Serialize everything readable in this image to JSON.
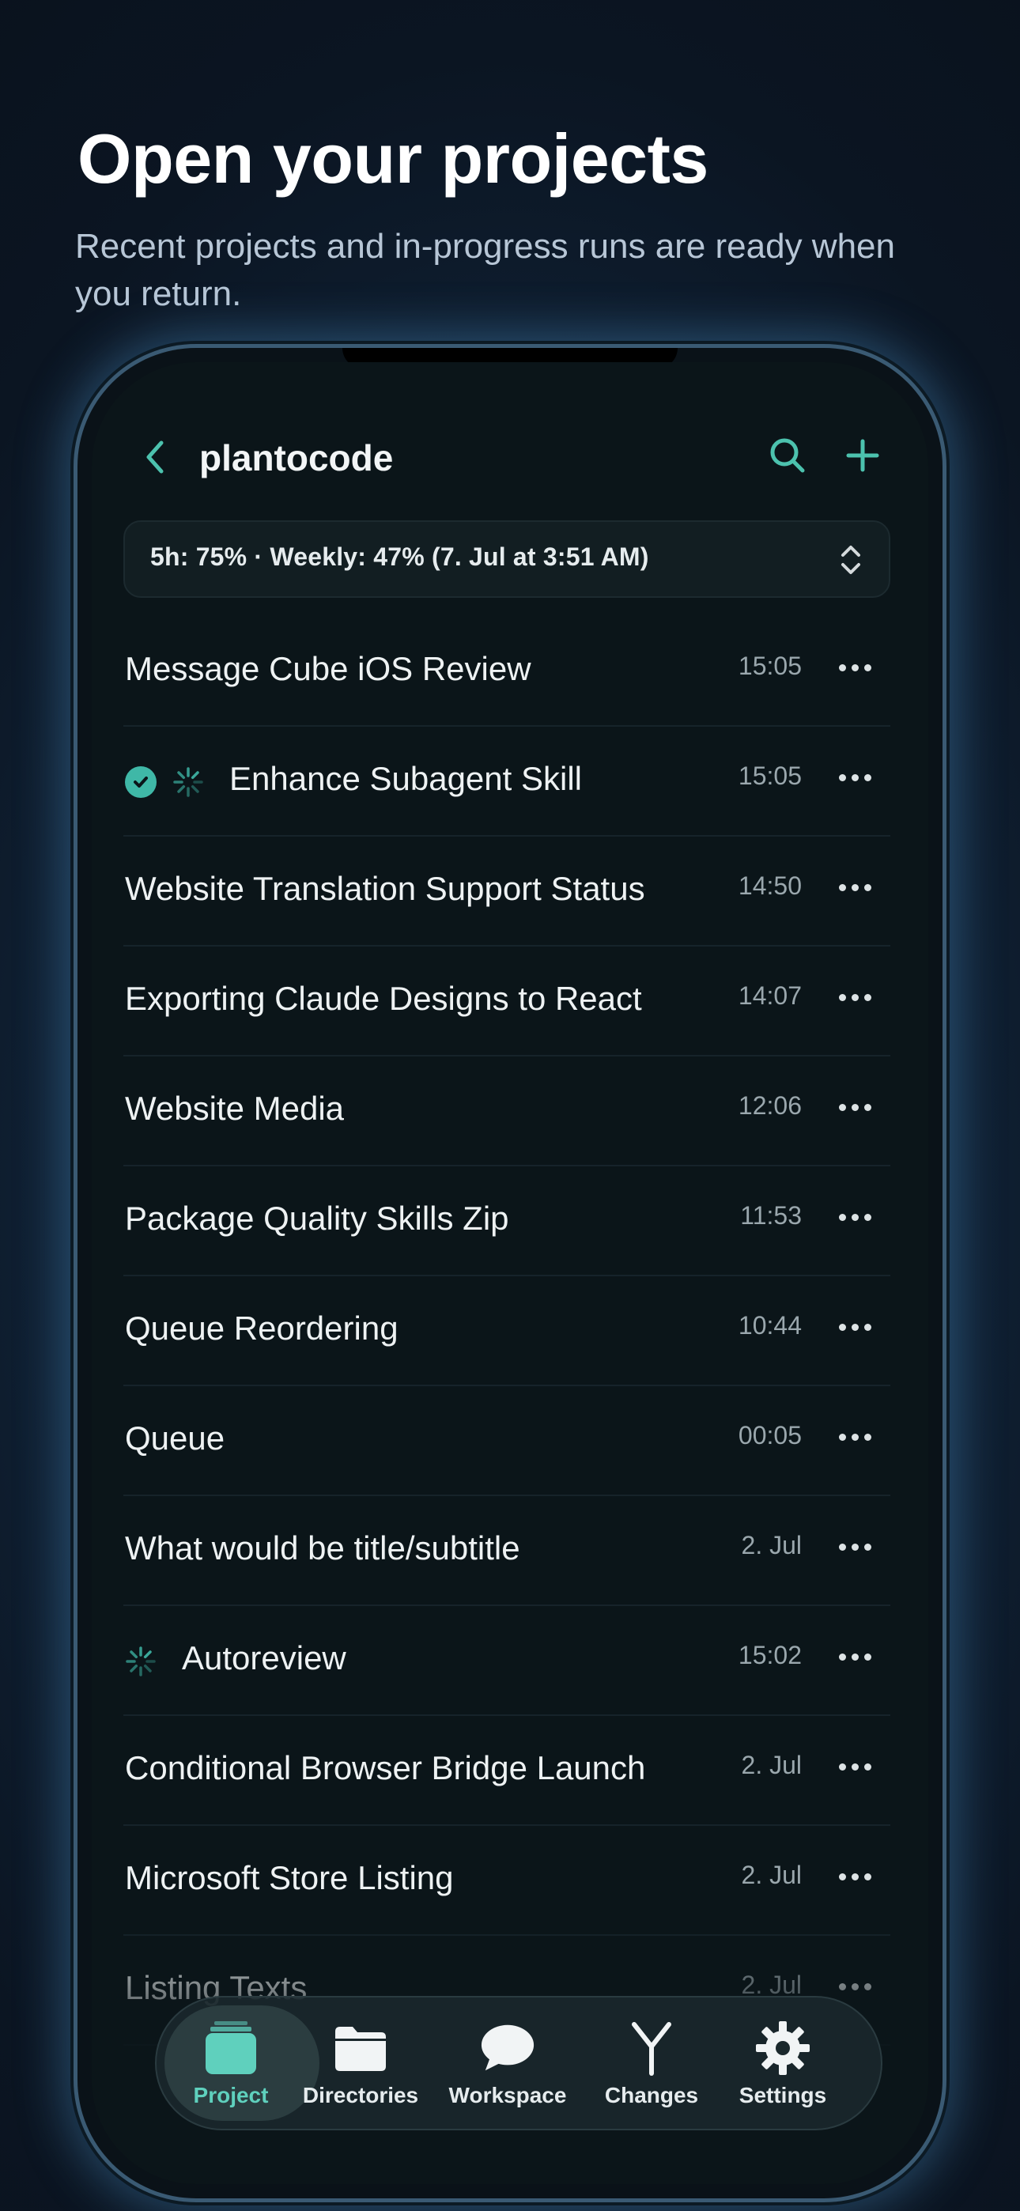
{
  "hero": {
    "title": "Open your projects",
    "subtitle": "Recent projects and in-progress runs are ready when you return."
  },
  "app": {
    "title": "plantocode",
    "back_icon": "chevron-left-icon",
    "search_icon": "search-icon",
    "add_icon": "plus-icon",
    "accent_color": "#3fb8a7"
  },
  "usage": {
    "text": "5h: 75%  ·  Weekly: 47% (7. Jul at 3:51 AM)",
    "toggle_icon": "chevron-up-down-icon"
  },
  "sessions": [
    {
      "title": "Message Cube iOS Review",
      "time": "15:05",
      "status": "none"
    },
    {
      "title": "Enhance Subagent Skill",
      "time": "15:05",
      "status": "done-running"
    },
    {
      "title": "Website Translation Support Status",
      "time": "14:50",
      "status": "none"
    },
    {
      "title": "Exporting Claude Designs to React",
      "time": "14:07",
      "status": "none"
    },
    {
      "title": "Website Media",
      "time": "12:06",
      "status": "none"
    },
    {
      "title": "Package Quality Skills Zip",
      "time": "11:53",
      "status": "none"
    },
    {
      "title": "Queue Reordering",
      "time": "10:44",
      "status": "none"
    },
    {
      "title": "Queue",
      "time": "00:05",
      "status": "none"
    },
    {
      "title": "What would be title/subtitle",
      "time": "2. Jul",
      "status": "none"
    },
    {
      "title": "Autoreview",
      "time": "15:02",
      "status": "running"
    },
    {
      "title": "Conditional Browser Bridge Launch",
      "time": "2. Jul",
      "status": "none"
    },
    {
      "title": "Microsoft Store Listing",
      "time": "2. Jul",
      "status": "none"
    },
    {
      "title": "Listing Texts",
      "time": "2. Jul",
      "status": "none"
    }
  ],
  "tabs": [
    {
      "label": "Project",
      "icon": "stack-icon",
      "active": true
    },
    {
      "label": "Directories",
      "icon": "folder-icon",
      "active": false
    },
    {
      "label": "Workspace",
      "icon": "chat-bubble-icon",
      "active": false
    },
    {
      "label": "Changes",
      "icon": "branch-icon",
      "active": false
    },
    {
      "label": "Settings",
      "icon": "gear-icon",
      "active": false
    }
  ]
}
